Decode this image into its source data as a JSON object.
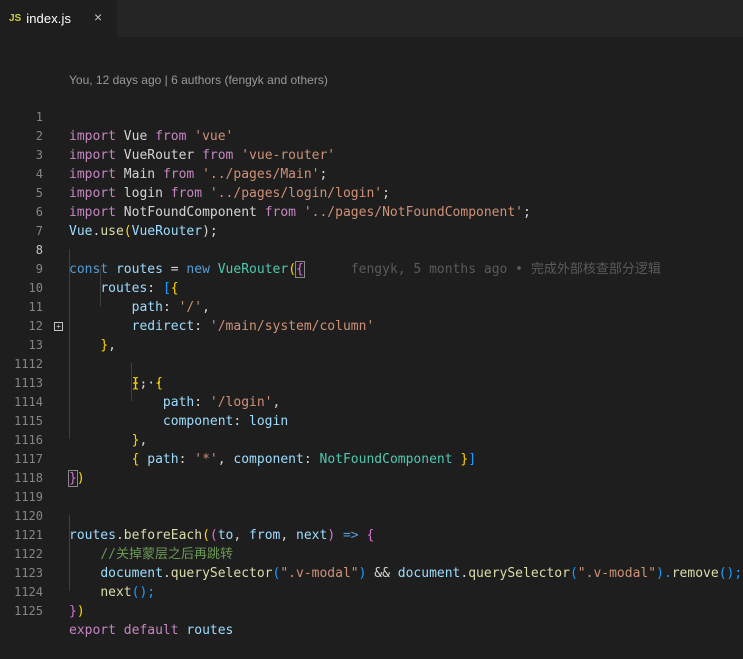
{
  "tab": {
    "icon_text": "JS",
    "filename": "index.js",
    "close_glyph": "×"
  },
  "blame_header": "You, 12 days ago | 6 authors (fengyk and others)",
  "inline_blame": "fengyk, 5 months ago • 完成外部核查部分逻辑",
  "fold_glyph": "+",
  "line_numbers": [
    "1",
    "2",
    "3",
    "4",
    "5",
    "6",
    "7",
    "8",
    "9",
    "10",
    "11",
    "12",
    "13",
    "1112",
    "1113",
    "1114",
    "1115",
    "1116",
    "1117",
    "1118",
    "1119",
    "1120",
    "1121",
    "1122",
    "1123",
    "1124",
    "1125"
  ],
  "code": {
    "l1": [
      "import",
      "Vue",
      "from",
      "'vue'"
    ],
    "l2": [
      "import",
      "VueRouter",
      "from",
      "'vue-router'"
    ],
    "l3": [
      "import",
      "Main",
      "from",
      "'../pages/Main'",
      ";"
    ],
    "l4": [
      "import",
      "login",
      "from",
      "'../pages/login/login'",
      ";"
    ],
    "l5": [
      "import",
      "NotFoundComponent",
      "from",
      "'../pages/NotFoundComponent'",
      ";"
    ],
    "l6": [
      "Vue",
      ".",
      "use",
      "(",
      "VueRouter",
      ");"
    ],
    "l8": [
      "const",
      "routes",
      "=",
      "new",
      "VueRouter",
      "(",
      "{"
    ],
    "l9": [
      "routes",
      ":",
      "[",
      "{"
    ],
    "l10": [
      "path",
      ":",
      "'/'",
      ","
    ],
    "l11": [
      "redirect",
      ":",
      "'/main/system/column'"
    ],
    "l12": [
      "}",
      ","
    ],
    "l13": [
      "{",
      "···"
    ],
    "l1112": [
      "}",
      ",",
      "{"
    ],
    "l1113": [
      "path",
      ":",
      "'/login'",
      ","
    ],
    "l1114": [
      "component",
      ":",
      "login"
    ],
    "l1115": [
      "}",
      ","
    ],
    "l1116": [
      "{",
      "path",
      ":",
      "'*'",
      ",",
      "component",
      ":",
      "NotFoundComponent",
      "}",
      "]"
    ],
    "l1117": [
      "}",
      ")"
    ],
    "l1120": [
      "routes",
      ".",
      "beforeEach",
      "(",
      "(",
      "to",
      ", ",
      "from",
      ", ",
      "next",
      ")",
      "=>",
      "{"
    ],
    "l1121": [
      "//关掉蒙层之后再跳转"
    ],
    "l1122": [
      "document",
      ".",
      "querySelector",
      "(",
      "\".v-modal\"",
      ")",
      " && ",
      "document",
      ".",
      "querySelector",
      "(",
      "\".v-modal\"",
      ").",
      "remove",
      "();"
    ],
    "l1123": [
      "next",
      "();"
    ],
    "l1124": [
      "}",
      ")"
    ],
    "l1125": [
      "export",
      "default",
      "routes"
    ]
  }
}
